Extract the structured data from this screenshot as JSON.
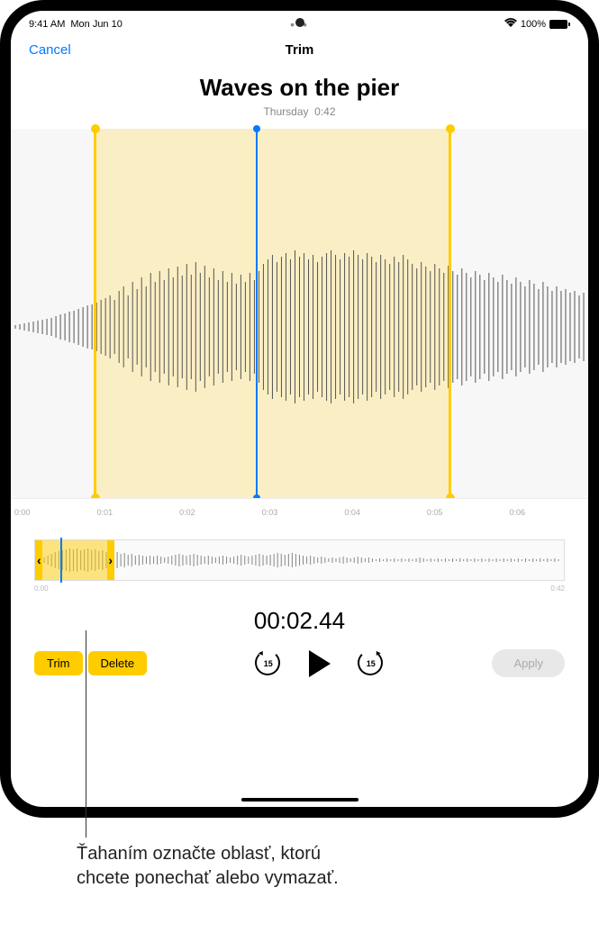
{
  "status_bar": {
    "time": "9:41 AM",
    "date": "Mon Jun 10",
    "battery_label": "100%"
  },
  "nav": {
    "cancel": "Cancel",
    "title": "Trim"
  },
  "recording": {
    "title": "Waves on the pier",
    "day": "Thursday",
    "duration": "0:42"
  },
  "ruler": {
    "t0": "0:00",
    "t1": "0:01",
    "t2": "0:02",
    "t3": "0:03",
    "t4": "0:04",
    "t5": "0:05",
    "t6": "0:06"
  },
  "overview": {
    "start": "0:00",
    "end": "0:42"
  },
  "timecode": "00:02.44",
  "buttons": {
    "trim": "Trim",
    "delete": "Delete",
    "skip_back": "15",
    "skip_forward": "15",
    "apply": "Apply"
  },
  "callout": "Ťahaním označte oblasť, ktorú chcete ponechať alebo vymazať."
}
